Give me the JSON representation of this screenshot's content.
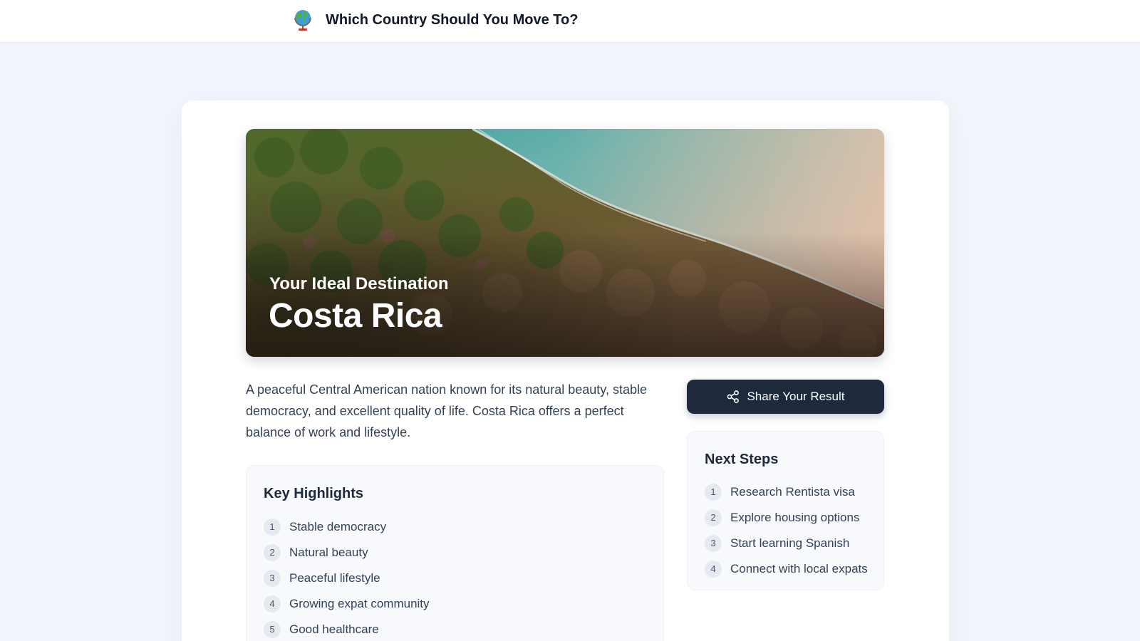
{
  "header": {
    "title": "Which Country Should You Move To?",
    "logo_icon": "globe-icon"
  },
  "hero": {
    "subtitle": "Your Ideal Destination",
    "country": "Costa Rica",
    "image": "aerial coastline forest photo"
  },
  "description": "A peaceful Central American nation known for its natural beauty, stable democracy, and excellent quality of life. Costa Rica offers a perfect balance of work and lifestyle.",
  "highlights": {
    "title": "Key Highlights",
    "items": [
      {
        "num": "1",
        "label": "Stable democracy"
      },
      {
        "num": "2",
        "label": "Natural beauty"
      },
      {
        "num": "3",
        "label": "Peaceful lifestyle"
      },
      {
        "num": "4",
        "label": "Growing expat community"
      },
      {
        "num": "5",
        "label": "Good healthcare"
      }
    ]
  },
  "share": {
    "label": "Share Your Result",
    "icon": "share-icon"
  },
  "next_steps": {
    "title": "Next Steps",
    "items": [
      {
        "num": "1",
        "label": "Research Rentista visa"
      },
      {
        "num": "2",
        "label": "Explore housing options"
      },
      {
        "num": "3",
        "label": "Start learning Spanish"
      },
      {
        "num": "4",
        "label": "Connect with local expats"
      }
    ]
  },
  "colors": {
    "page_bg": "#f2f6fc",
    "primary_button": "#1e293b",
    "panel_bg": "#f7f9fc",
    "badge_bg": "#e6eaf0"
  }
}
